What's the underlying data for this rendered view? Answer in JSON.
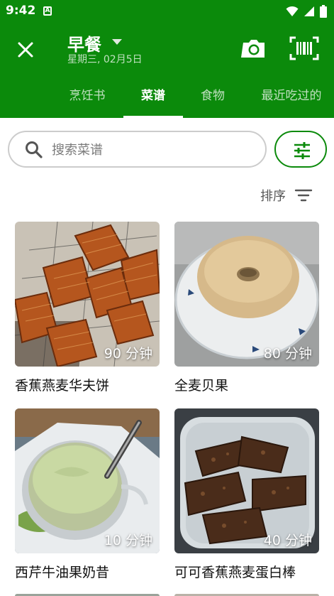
{
  "status_bar": {
    "time": "9:42",
    "notification_icon": "A"
  },
  "app_bar": {
    "title": "早餐",
    "subtitle": "星期三, 02月5日",
    "icons": [
      "close-icon",
      "chevron-down-icon",
      "camera-icon",
      "barcode-icon"
    ]
  },
  "tabs": [
    {
      "label": "烹饪书",
      "active": false
    },
    {
      "label": "菜谱",
      "active": true
    },
    {
      "label": "食物",
      "active": false
    },
    {
      "label": "最近吃过的",
      "active": false
    }
  ],
  "search": {
    "placeholder": "搜索菜谱",
    "value": ""
  },
  "sort": {
    "label": "排序"
  },
  "recipes": [
    {
      "name": "香蕉燕麦华夫饼",
      "duration": "90 分钟"
    },
    {
      "name": "全麦贝果",
      "duration": "80 分钟"
    },
    {
      "name": "西芹牛油果奶昔",
      "duration": "10 分钟"
    },
    {
      "name": "可可香蕉燕麦蛋白棒",
      "duration": "40 分钟"
    }
  ],
  "colors": {
    "brand_green": "#0b8a0b",
    "inactive_tab": "#bfe0bf"
  }
}
